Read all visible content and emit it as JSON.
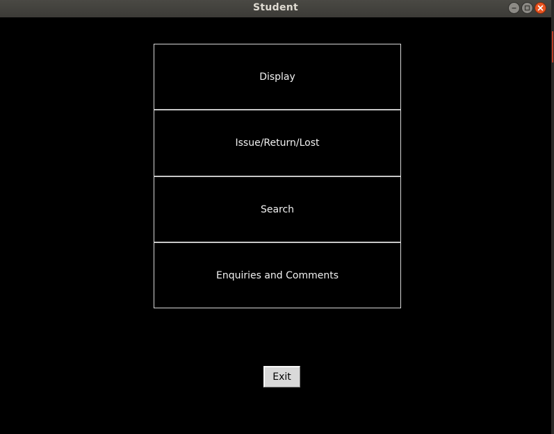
{
  "window": {
    "title": "Student",
    "controls": {
      "minimize_icon": "minimize-icon",
      "maximize_icon": "maximize-icon",
      "close_icon": "close-icon"
    }
  },
  "menu": {
    "items": [
      {
        "label": "Display"
      },
      {
        "label": "Issue/Return/Lost"
      },
      {
        "label": "Search"
      },
      {
        "label": "Enquiries and Comments"
      }
    ]
  },
  "footer": {
    "exit_label": "Exit"
  },
  "colors": {
    "background": "#000000",
    "titlebar": "#3c3b37",
    "close_button": "#e95420",
    "button_text": "#f2f2f2",
    "button_border": "#d9d9d9",
    "exit_button_bg": "#d9d9d9"
  }
}
